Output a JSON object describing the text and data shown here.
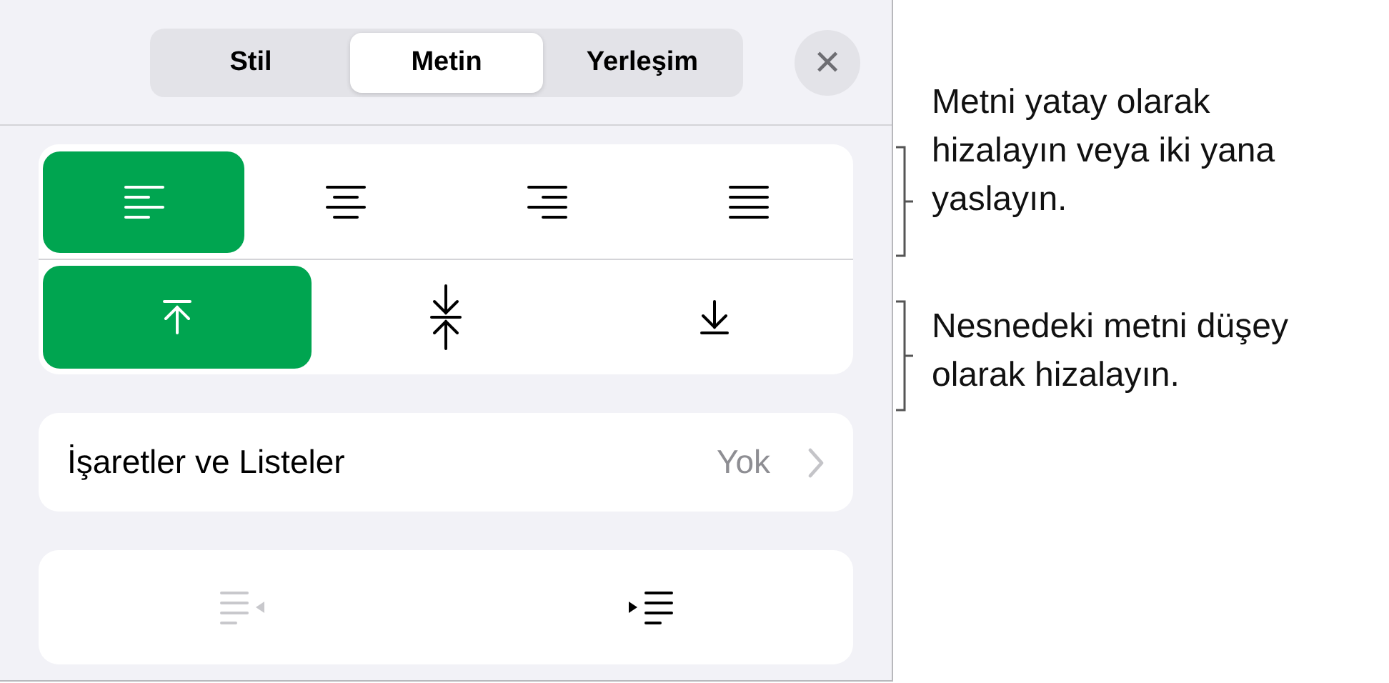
{
  "tabs": [
    {
      "label": "Stil",
      "selected": false
    },
    {
      "label": "Metin",
      "selected": true
    },
    {
      "label": "Yerleşim",
      "selected": false
    }
  ],
  "close_button": {
    "label": "✕"
  },
  "horizontal_alignment": [
    {
      "kind": "left",
      "selected": true
    },
    {
      "kind": "center",
      "selected": false
    },
    {
      "kind": "right",
      "selected": false
    },
    {
      "kind": "justify",
      "selected": false
    }
  ],
  "vertical_alignment": [
    {
      "kind": "top",
      "selected": true
    },
    {
      "kind": "middle",
      "selected": false
    },
    {
      "kind": "bottom",
      "selected": false
    }
  ],
  "bullets_row": {
    "label": "İşaretler ve Listeler",
    "value": "Yok"
  },
  "indent_buttons": [
    {
      "kind": "decrease",
      "disabled": true
    },
    {
      "kind": "increase",
      "disabled": false
    }
  ],
  "callouts": [
    {
      "text": "Metni yatay olarak hizalayın veya iki yana yaslayın."
    },
    {
      "text": "Nesnedeki metni düşey olarak hizalayın."
    }
  ]
}
